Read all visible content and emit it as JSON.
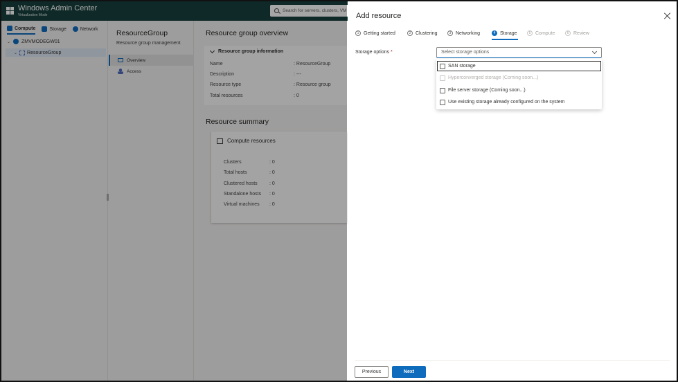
{
  "app": {
    "title": "Windows Admin Center",
    "subtitle": "Virtualization Mode",
    "search_placeholder": "Search for servers, clusters, VM"
  },
  "nav": {
    "tabs": [
      {
        "label": "Compute",
        "icon": "compute-icon",
        "color": "#0f6cbd",
        "active": true
      },
      {
        "label": "Storage",
        "icon": "storage-icon",
        "color": "#0f6cbd",
        "active": false
      },
      {
        "label": "Network",
        "icon": "network-icon",
        "color": "#0f6cbd",
        "active": false
      }
    ],
    "tree": {
      "host": "ZMVMODEGW01",
      "group": "ResourceGroup"
    }
  },
  "subnav": {
    "title": "ResourceGroup",
    "subtitle": "Resource group management",
    "items": [
      {
        "label": "Overview",
        "active": true
      },
      {
        "label": "Access",
        "active": false
      }
    ]
  },
  "overview": {
    "heading": "Resource group overview",
    "info_heading": "Resource group information",
    "info_rows": [
      {
        "key": "Name",
        "value": ": ResourceGroup"
      },
      {
        "key": "Description",
        "value": ": ---"
      },
      {
        "key": "Resource type",
        "value": ": Resource group"
      },
      {
        "key": "Total resources",
        "value": ": 0"
      }
    ],
    "summary_heading": "Resource summary",
    "compute_title": "Compute resources",
    "compute_rows": [
      {
        "key": "Clusters",
        "value": ": 0"
      },
      {
        "key": "Total hosts",
        "value": ": 0"
      },
      {
        "key": "Clustered hosts",
        "value": ": 0"
      },
      {
        "key": "Standalone hosts",
        "value": ": 0"
      },
      {
        "key": "Virtual machines",
        "value": ": 0"
      }
    ]
  },
  "panel": {
    "title": "Add resource",
    "steps": [
      {
        "num": "1",
        "label": "Getting started",
        "state": "normal"
      },
      {
        "num": "2",
        "label": "Clustering",
        "state": "normal"
      },
      {
        "num": "3",
        "label": "Networking",
        "state": "normal"
      },
      {
        "num": "4",
        "label": "Storage",
        "state": "active"
      },
      {
        "num": "5",
        "label": "Compute",
        "state": "disabled"
      },
      {
        "num": "6",
        "label": "Review",
        "state": "disabled"
      }
    ],
    "storage_label": "Storage options",
    "required_mark": "*",
    "select_placeholder": "Select storage options",
    "options": [
      {
        "label": "SAN storage",
        "disabled": false,
        "focused": true
      },
      {
        "label": "Hyperconverged storage (Coming soon...)",
        "disabled": true,
        "focused": false
      },
      {
        "label": "File server storage (Coming soon...)",
        "disabled": false,
        "focused": false
      },
      {
        "label": "Use existing storage already configured on the system",
        "disabled": false,
        "focused": false
      }
    ],
    "previous_label": "Previous",
    "next_label": "Next"
  },
  "colors": {
    "topbar": "#16403d",
    "accent": "#0f6cbd"
  }
}
